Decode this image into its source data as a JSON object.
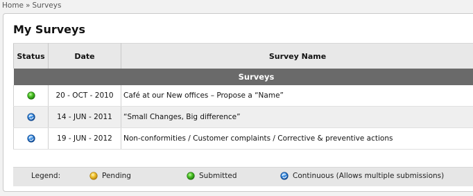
{
  "breadcrumb": {
    "home": "Home",
    "separator": "»",
    "current": "Surveys"
  },
  "page_title": "My Surveys",
  "table": {
    "headers": {
      "status": "Status",
      "date": "Date",
      "name": "Survey Name"
    },
    "group_label": "Surveys",
    "rows": [
      {
        "status_icon": "submitted-green-icon",
        "date": "20 - OCT - 2010",
        "name": "Café at our New offices – Propose a “Name”"
      },
      {
        "status_icon": "continuous-blue-icon",
        "date": "14 - JUN - 2011",
        "name": "“Small Changes, Big difference”"
      },
      {
        "status_icon": "continuous-blue-icon",
        "date": "19 - JUN - 2012",
        "name": "Non-conformities / Customer complaints / Corrective & preventive actions"
      }
    ]
  },
  "legend": {
    "label": "Legend:",
    "pending": "Pending",
    "submitted": "Submitted",
    "continuous": "Continuous (Allows multiple submissions)"
  },
  "colors": {
    "pending": "#f2c531",
    "submitted": "#3fb51d",
    "continuous": "#1f6fc8",
    "group_bar": "#6a6a6a"
  }
}
